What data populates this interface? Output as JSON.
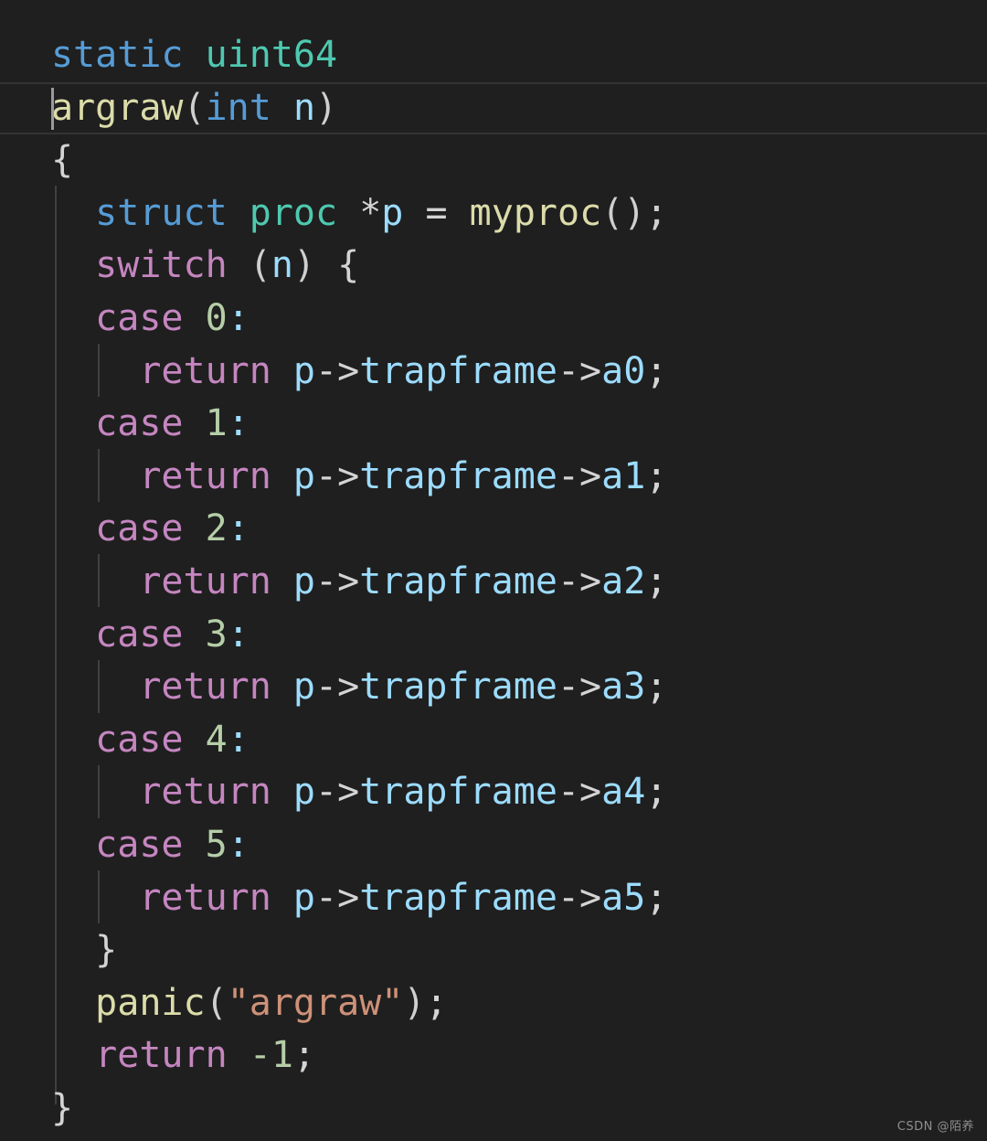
{
  "editor": {
    "language": "c",
    "theme": "dark-plus",
    "background_color": "#1f1f1f",
    "default_text_color": "#d4d4d4",
    "font_size_px": 40,
    "line_height_px": 57.6,
    "cursor": {
      "line": 2,
      "column": 1,
      "color": "#9a9a9a"
    },
    "current_line": 2,
    "current_line_border_color": "#333333",
    "indent_guide_color": "#404040"
  },
  "palette": {
    "keyword": "#569cd6",
    "type": "#4ec9b0",
    "control": "#c586c0",
    "function": "#dcdcaa",
    "variable": "#9cdcfe",
    "number": "#b5cea8",
    "string": "#ce9178",
    "punctuation": "#d4d4d4"
  },
  "code": {
    "lines": [
      {
        "n": 1,
        "text": "static uint64",
        "indent": 0
      },
      {
        "n": 2,
        "text": "argraw(int n)",
        "indent": 0
      },
      {
        "n": 3,
        "text": "{",
        "indent": 0
      },
      {
        "n": 4,
        "text": "  struct proc *p = myproc();",
        "indent": 1
      },
      {
        "n": 5,
        "text": "  switch (n) {",
        "indent": 1
      },
      {
        "n": 6,
        "text": "  case 0:",
        "indent": 1
      },
      {
        "n": 7,
        "text": "    return p->trapframe->a0;",
        "indent": 2
      },
      {
        "n": 8,
        "text": "  case 1:",
        "indent": 1
      },
      {
        "n": 9,
        "text": "    return p->trapframe->a1;",
        "indent": 2
      },
      {
        "n": 10,
        "text": "  case 2:",
        "indent": 1
      },
      {
        "n": 11,
        "text": "    return p->trapframe->a2;",
        "indent": 2
      },
      {
        "n": 12,
        "text": "  case 3:",
        "indent": 1
      },
      {
        "n": 13,
        "text": "    return p->trapframe->a3;",
        "indent": 2
      },
      {
        "n": 14,
        "text": "  case 4:",
        "indent": 1
      },
      {
        "n": 15,
        "text": "    return p->trapframe->a4;",
        "indent": 2
      },
      {
        "n": 16,
        "text": "  case 5:",
        "indent": 1
      },
      {
        "n": 17,
        "text": "    return p->trapframe->a5;",
        "indent": 2
      },
      {
        "n": 18,
        "text": "  }",
        "indent": 1
      },
      {
        "n": 19,
        "text": "  panic(\"argraw\");",
        "indent": 1
      },
      {
        "n": 20,
        "text": "  return -1;",
        "indent": 1
      },
      {
        "n": 21,
        "text": "}",
        "indent": 0
      }
    ],
    "tokens": {
      "l1": {
        "kw": "static",
        "type": "uint64"
      },
      "l2": {
        "fn": "argraw",
        "open": "(",
        "kw": "int",
        "var": "n",
        "close": ")"
      },
      "l3": {
        "brace": "{"
      },
      "l4": {
        "kw": "struct",
        "type": "proc",
        "star": "*",
        "var_p": "p",
        "eq": "=",
        "fn": "myproc",
        "call": "();"
      },
      "l5": {
        "ctrl": "switch",
        "open": "(",
        "var": "n",
        "close": ")",
        "brace": "{"
      },
      "case_kw": "case",
      "colon": ":",
      "return_kw": "return",
      "var_p": "p",
      "arrow": "->",
      "trapframe": "trapframe",
      "semi": ";",
      "regs": [
        "a0",
        "a1",
        "a2",
        "a3",
        "a4",
        "a5"
      ],
      "case_nums": [
        "0",
        "1",
        "2",
        "3",
        "4",
        "5"
      ],
      "l18": {
        "brace": "}"
      },
      "l19": {
        "fn": "panic",
        "open": "(",
        "str": "\"argraw\"",
        "close": ")",
        "semi": ";"
      },
      "l20": {
        "ctrl": "return",
        "num": "-1",
        "semi": ";"
      },
      "l21": {
        "brace": "}"
      }
    }
  },
  "watermark": {
    "text": "CSDN @陌养",
    "color": "#8f8f8f"
  }
}
